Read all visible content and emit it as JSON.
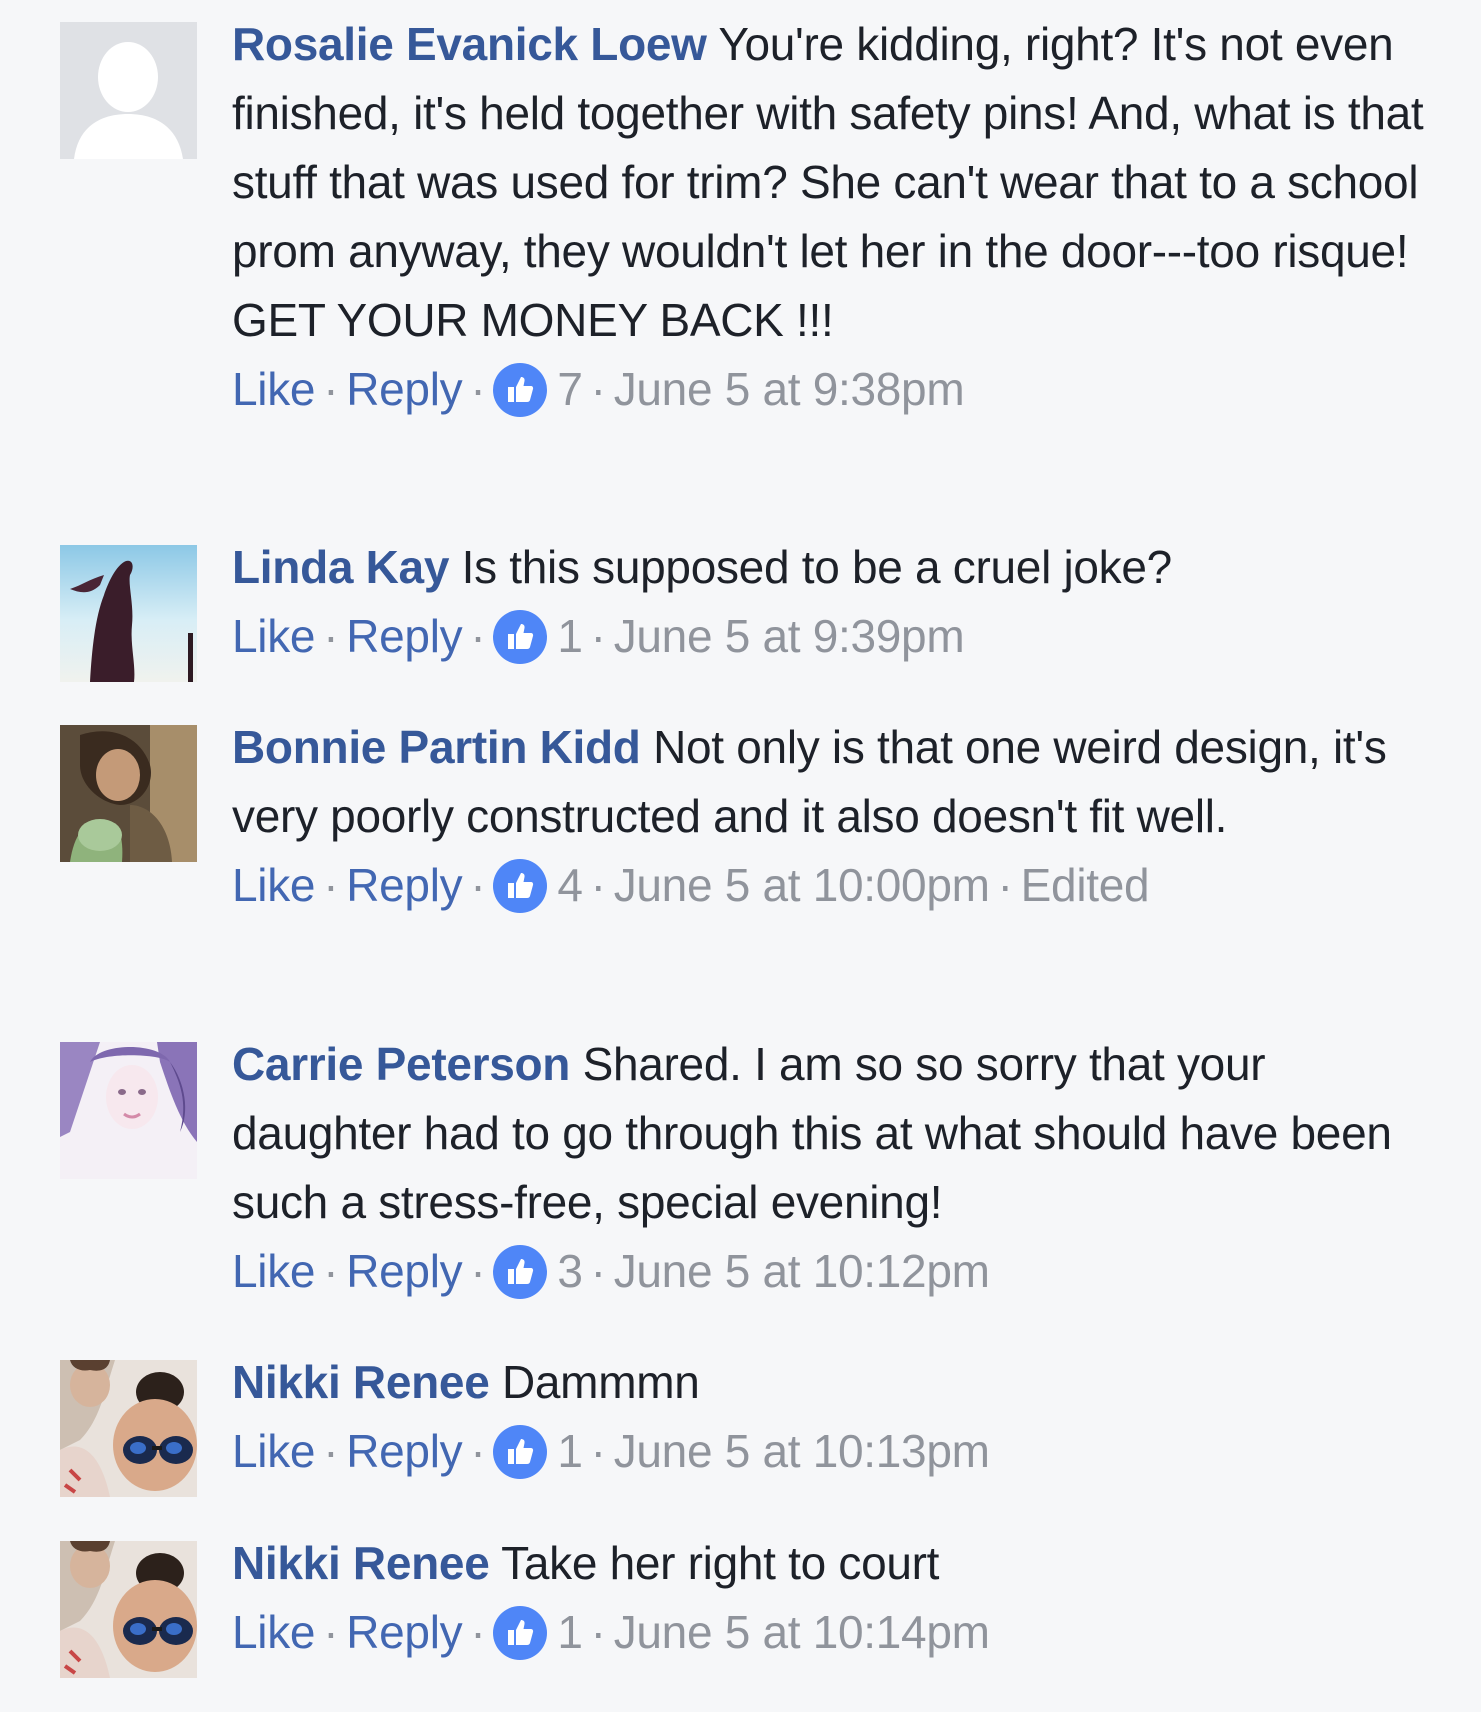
{
  "colors": {
    "background": "#f6f7f9",
    "author": "#365899",
    "link": "#4267b2",
    "meta": "#90949c",
    "like_badge": "#4f86f7"
  },
  "comments": [
    {
      "author": "Rosalie Evanick Loew",
      "text": "You're kidding, right? It's not even finished, it's held together with safety pins! And, what is that stuff that was used for trim? She can't wear that to a school prom anyway, they wouldn't let her in the door---too risque! GET YOUR MONEY BACK !!!",
      "like_label": "Like",
      "reply_label": "Reply",
      "reactions_icon": "thumbs-up-icon",
      "reactions": "7",
      "timestamp": "June 5 at 9:38pm",
      "edited": ""
    },
    {
      "author": "Linda Kay",
      "text": "Is this supposed to be a cruel joke?",
      "like_label": "Like",
      "reply_label": "Reply",
      "reactions_icon": "thumbs-up-icon",
      "reactions": "1",
      "timestamp": "June 5 at 9:39pm",
      "edited": ""
    },
    {
      "author": "Bonnie Partin Kidd",
      "text": "Not only is that one weird design, it's very poorly constructed and it also doesn't fit well.",
      "like_label": "Like",
      "reply_label": "Reply",
      "reactions_icon": "thumbs-up-icon",
      "reactions": "4",
      "timestamp": "June 5 at 10:00pm",
      "edited": "Edited"
    },
    {
      "author": "Carrie Peterson",
      "text": "Shared. I am so so sorry that your daughter had to go through this at what should have been such a stress-free, special evening!",
      "like_label": "Like",
      "reply_label": "Reply",
      "reactions_icon": "thumbs-up-icon",
      "reactions": "3",
      "timestamp": "June 5 at 10:12pm",
      "edited": ""
    },
    {
      "author": "Nikki Renee",
      "text": "Dammmn",
      "like_label": "Like",
      "reply_label": "Reply",
      "reactions_icon": "thumbs-up-icon",
      "reactions": "1",
      "timestamp": "June 5 at 10:13pm",
      "edited": ""
    },
    {
      "author": "Nikki Renee",
      "text": "Take her right to court",
      "like_label": "Like",
      "reply_label": "Reply",
      "reactions_icon": "thumbs-up-icon",
      "reactions": "1",
      "timestamp": "June 5 at 10:14pm",
      "edited": ""
    }
  ]
}
